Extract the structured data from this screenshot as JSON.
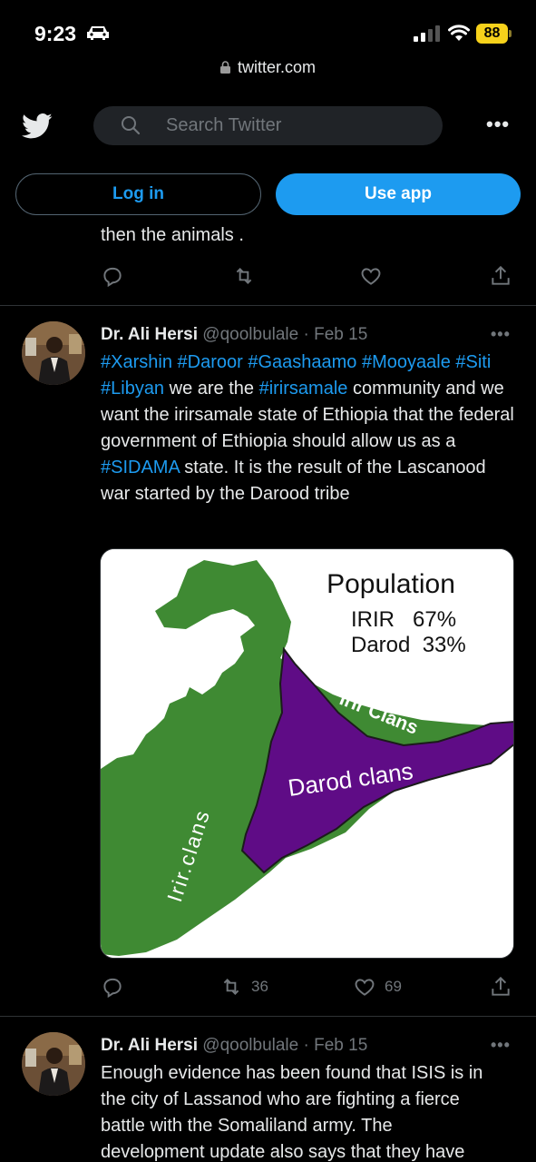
{
  "status_bar": {
    "time": "9:23",
    "battery": "88",
    "icons": [
      "car-icon",
      "signal-icon",
      "wifi-icon",
      "battery-icon"
    ]
  },
  "browser": {
    "url": "twitter.com"
  },
  "header": {
    "search_placeholder": "Search Twitter",
    "login_label": "Log in",
    "use_app_label": "Use app"
  },
  "previous_tweet": {
    "tail_text": "then the animals ."
  },
  "tweets": [
    {
      "name": "Dr. Ali Hersi",
      "handle": "@qoolbulale",
      "date": "· Feb 15",
      "body": [
        {
          "t": "#Xarshin",
          "tag": true
        },
        {
          "t": " "
        },
        {
          "t": "#Daroor",
          "tag": true
        },
        {
          "t": " "
        },
        {
          "t": "#Gaashaamo",
          "tag": true
        },
        {
          "t": " "
        },
        {
          "t": "#Mooyaale",
          "tag": true
        },
        {
          "t": " "
        },
        {
          "t": "#Siti",
          "tag": true
        },
        {
          "t": " "
        },
        {
          "t": "#Libyan",
          "tag": true
        },
        {
          "t": " we are the "
        },
        {
          "t": "#irirsamale",
          "tag": true
        },
        {
          "t": " community and we want the irirsamale state of Ethiopia that the federal government of Ethiopia should allow us as a "
        },
        {
          "t": "#SIDAMA",
          "tag": true
        },
        {
          "t": " state. It is the result of the Lascanood war started by the Darood tribe"
        }
      ],
      "media": {
        "title": "Population",
        "line1": "IRIR   67%",
        "line2": "Darod  33%",
        "label_irir_top": "Irir Clans",
        "label_darod": "Darod clans",
        "label_irir_left": "Irir.clans",
        "colors": {
          "green": "#3f8a33",
          "purple": "#5f0c86"
        }
      },
      "retweets": "36",
      "likes": "69"
    },
    {
      "name": "Dr. Ali Hersi",
      "handle": "@qoolbulale",
      "date": "· Feb 15",
      "body_lines": [
        "Enough evidence has been found that ISIS is in",
        "the city of Lassanod who are fighting a fierce",
        "battle with the Somaliland army. The",
        "development update also says that they have"
      ]
    }
  ],
  "colors": {
    "accent": "#1d9bf0",
    "muted": "#71767b",
    "divider": "#2f3336"
  }
}
